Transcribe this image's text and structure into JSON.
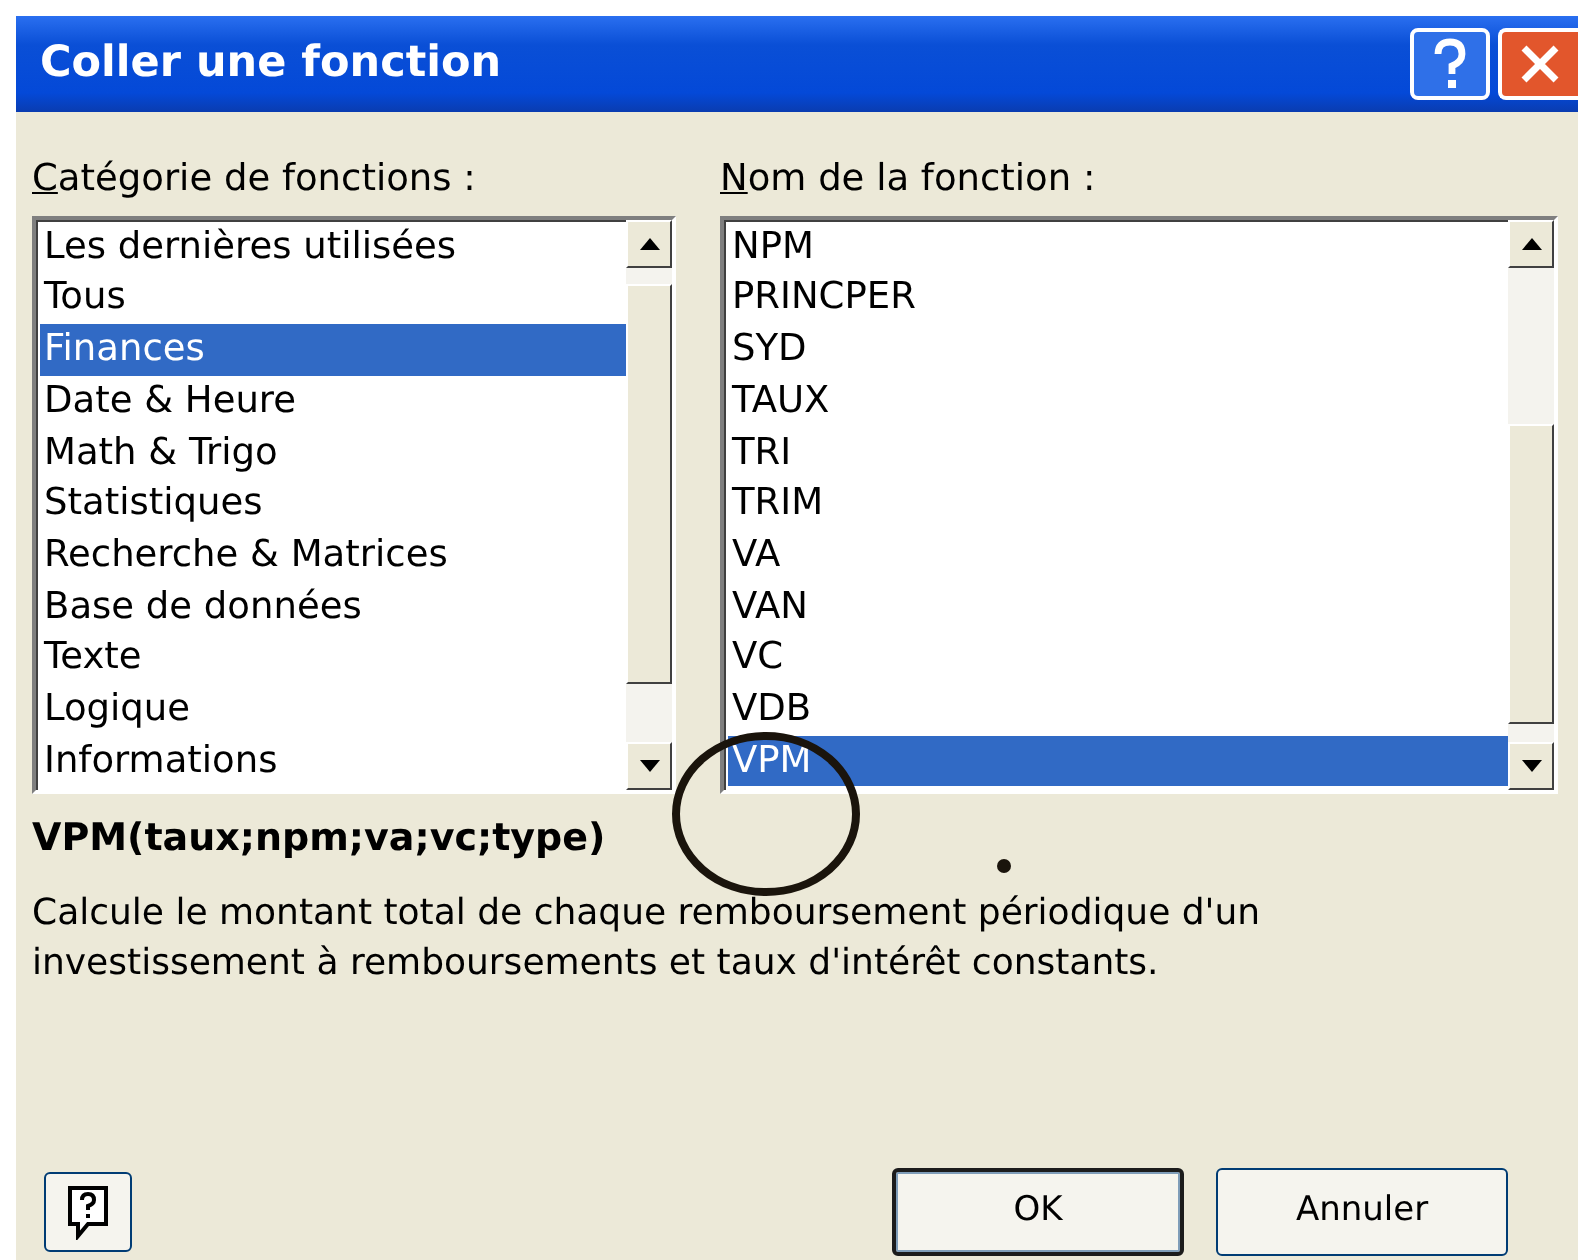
{
  "window": {
    "title": "Coller une fonction"
  },
  "categories": {
    "label": "Catégorie de fonctions :",
    "items": [
      {
        "label": "Les dernières utilisées",
        "selected": false
      },
      {
        "label": "Tous",
        "selected": false
      },
      {
        "label": "Finances",
        "selected": true
      },
      {
        "label": "Date & Heure",
        "selected": false
      },
      {
        "label": "Math & Trigo",
        "selected": false
      },
      {
        "label": "Statistiques",
        "selected": false
      },
      {
        "label": "Recherche & Matrices",
        "selected": false
      },
      {
        "label": "Base de données",
        "selected": false
      },
      {
        "label": "Texte",
        "selected": false
      },
      {
        "label": "Logique",
        "selected": false
      },
      {
        "label": "Informations",
        "selected": false
      }
    ]
  },
  "functions": {
    "label": "Nom de la fonction :",
    "items": [
      {
        "label": "NPM",
        "selected": false
      },
      {
        "label": "PRINCPER",
        "selected": false
      },
      {
        "label": "SYD",
        "selected": false
      },
      {
        "label": "TAUX",
        "selected": false
      },
      {
        "label": "TRI",
        "selected": false
      },
      {
        "label": "TRIM",
        "selected": false
      },
      {
        "label": "VA",
        "selected": false
      },
      {
        "label": "VAN",
        "selected": false
      },
      {
        "label": "VC",
        "selected": false
      },
      {
        "label": "VDB",
        "selected": false
      },
      {
        "label": "VPM",
        "selected": true
      }
    ]
  },
  "signature": "VPM(taux;npm;va;vc;type)",
  "description": "Calcule le montant total de chaque remboursement périodique d'un investissement à remboursements et taux d'intérêt constants.",
  "buttons": [
    {
      "label": "OK",
      "default": true
    },
    {
      "label": "Annuler",
      "default": false
    }
  ]
}
